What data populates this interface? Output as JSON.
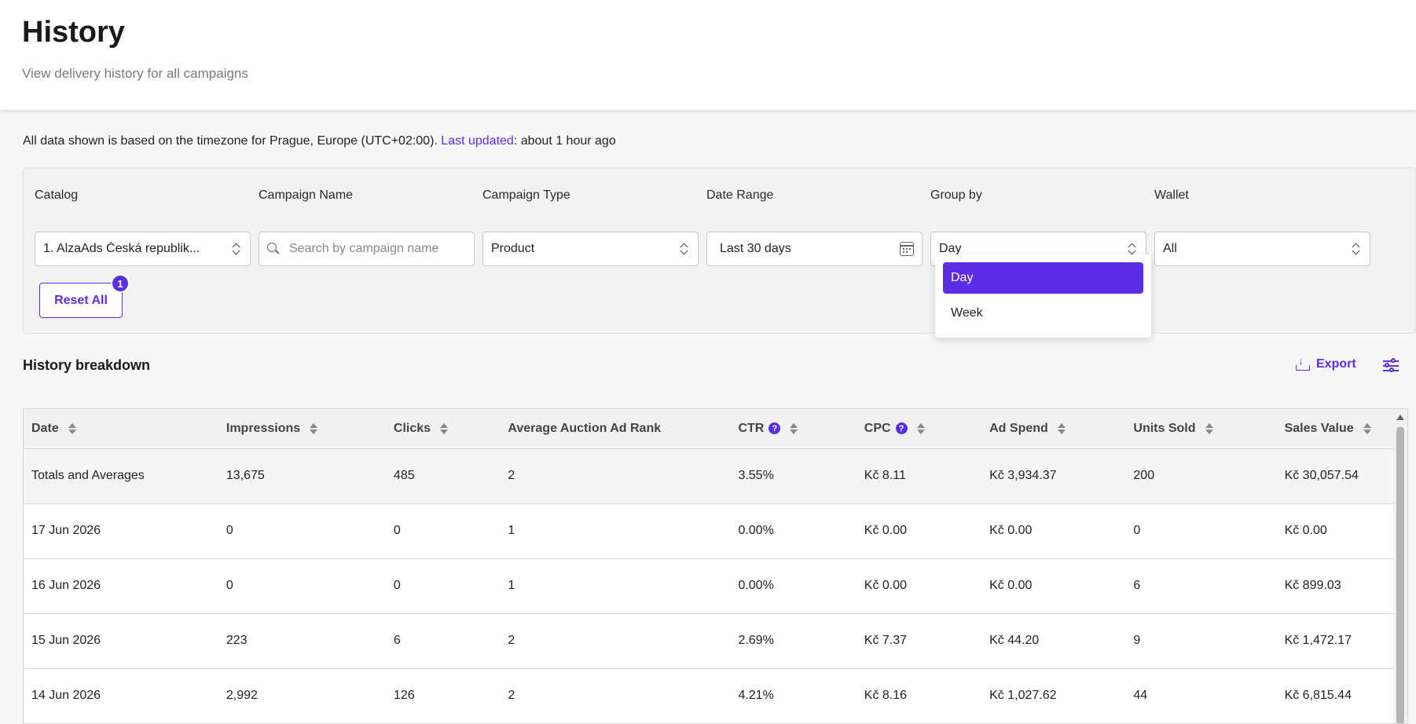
{
  "header": {
    "title": "History",
    "subtitle": "View delivery history for all campaigns"
  },
  "timezone": {
    "prefix": "All data shown is based on the timezone for Prague, Europe (UTC+02:00). ",
    "link": "Last updated",
    "suffix": ": about 1 hour ago"
  },
  "filters": {
    "catalog": {
      "label": "Catalog",
      "value": "1. AlzaAds Česká republik..."
    },
    "campaign_name": {
      "label": "Campaign Name",
      "placeholder": "Search by campaign name"
    },
    "campaign_type": {
      "label": "Campaign Type",
      "value": "Product"
    },
    "date_range": {
      "label": "Date Range",
      "value": "Last 30 days"
    },
    "group_by": {
      "label": "Group by",
      "value": "Day",
      "options": [
        "Day",
        "Week"
      ]
    },
    "wallet": {
      "label": "Wallet",
      "value": "All"
    },
    "reset_label": "Reset All",
    "reset_badge": "1"
  },
  "breakdown": {
    "title": "History breakdown",
    "export_label": "Export"
  },
  "table": {
    "columns": [
      "Date",
      "Impressions",
      "Clicks",
      "Average Auction Ad Rank",
      "CTR",
      "CPC",
      "Ad Spend",
      "Units Sold",
      "Sales Value"
    ],
    "rows": [
      [
        "Totals and Averages",
        "13,675",
        "485",
        "2",
        "3.55%",
        "Kč 8.11",
        "Kč 3,934.37",
        "200",
        "Kč 30,057.54"
      ],
      [
        "17 Jun 2026",
        "0",
        "0",
        "1",
        "0.00%",
        "Kč 0.00",
        "Kč 0.00",
        "0",
        "Kč 0.00"
      ],
      [
        "16 Jun 2026",
        "0",
        "0",
        "1",
        "0.00%",
        "Kč 0.00",
        "Kč 0.00",
        "6",
        "Kč 899.03"
      ],
      [
        "15 Jun 2026",
        "223",
        "6",
        "2",
        "2.69%",
        "Kč 7.37",
        "Kč 44.20",
        "9",
        "Kč 1,472.17"
      ],
      [
        "14 Jun 2026",
        "2,992",
        "126",
        "2",
        "4.21%",
        "Kč 8.16",
        "Kč 1,027.62",
        "44",
        "Kč 6,815.44"
      ]
    ]
  },
  "colors": {
    "accent": "#5b2ee6"
  }
}
